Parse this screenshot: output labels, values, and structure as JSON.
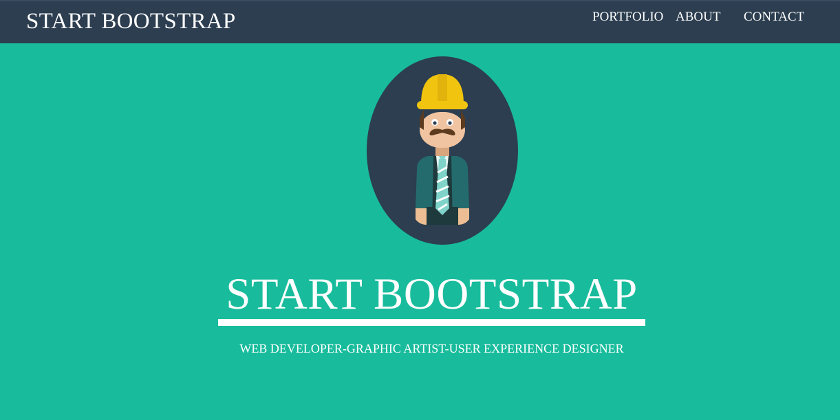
{
  "navbar": {
    "brand": "START BOOTSTRAP",
    "links": [
      {
        "label": "PORTFOLIO"
      },
      {
        "label": "ABOUT"
      },
      {
        "label": "CONTACT"
      }
    ]
  },
  "hero": {
    "avatar_icon": "construction-worker-avatar-icon",
    "title": "START BOOTSTRAP",
    "subtitle": "WEB DEVELOPER-GRAPHIC ARTIST-USER EXPERIENCE DESIGNER"
  },
  "colors": {
    "navbar_bg": "#2C3E50",
    "hero_bg": "#18BC9C",
    "text": "#FFFFFF",
    "helmet": "#F1C40F"
  }
}
